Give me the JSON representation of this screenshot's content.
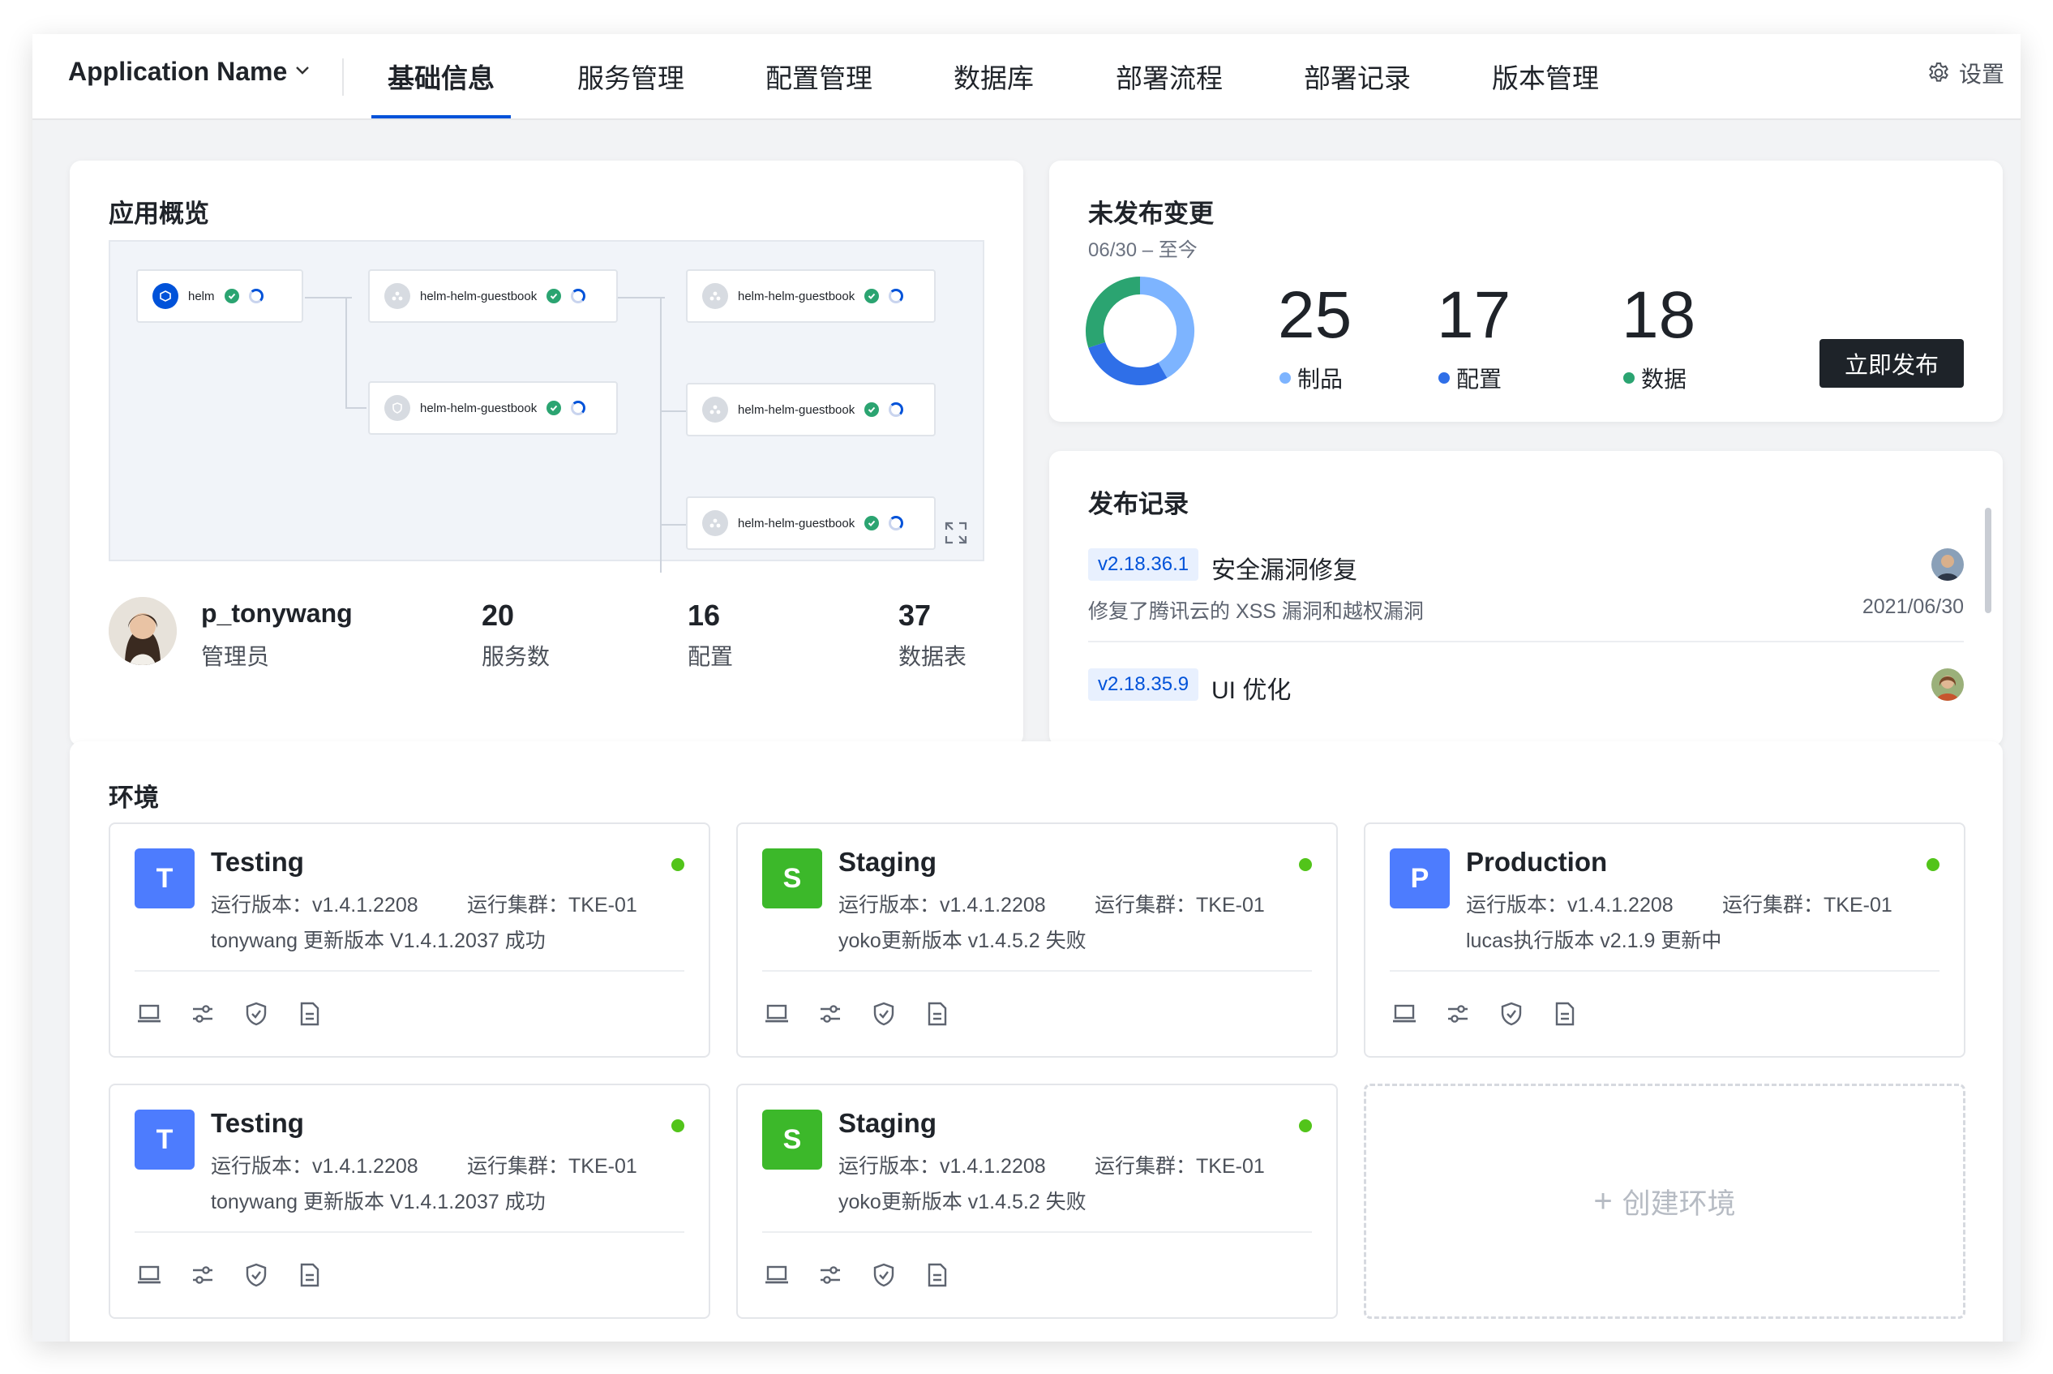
{
  "header": {
    "app_name": "Application Name",
    "tabs": [
      "基础信息",
      "服务管理",
      "配置管理",
      "数据库",
      "部署流程",
      "部署记录",
      "版本管理"
    ],
    "active_tab": "基础信息",
    "settings_label": "设置"
  },
  "overview": {
    "title": "应用概览",
    "nodes": [
      {
        "label": "helm"
      },
      {
        "label": "helm-helm-guestbook"
      },
      {
        "label": "helm-helm-guestbook"
      },
      {
        "label": "helm-helm-guestbook"
      },
      {
        "label": "helm-helm-guestbook"
      },
      {
        "label": "helm-helm-guestbook"
      }
    ],
    "user": {
      "name": "p_tonywang",
      "role": "管理员"
    },
    "stats": [
      {
        "value": "20",
        "label": "服务数"
      },
      {
        "value": "16",
        "label": "配置"
      },
      {
        "value": "37",
        "label": "数据表"
      }
    ]
  },
  "unpublished": {
    "title": "未发布变更",
    "date_range": "06/30 – 至今",
    "items": [
      {
        "value": "25",
        "label": "制品",
        "color": "#7db4ff"
      },
      {
        "value": "17",
        "label": "配置",
        "color": "#2f6fe8"
      },
      {
        "value": "18",
        "label": "数据",
        "color": "#2ba471"
      }
    ],
    "publish_button": "立即发布",
    "donut_colors": [
      "#7db4ff",
      "#2f6fe8",
      "#2ba471"
    ]
  },
  "releases": {
    "title": "发布记录",
    "items": [
      {
        "version": "v2.18.36.1",
        "title": "安全漏洞修复",
        "desc": "修复了腾讯云的 XSS 漏洞和越权漏洞",
        "date": "2021/06/30"
      },
      {
        "version": "v2.18.35.9",
        "title": "UI 优化"
      }
    ]
  },
  "environments": {
    "title": "环境",
    "cards": [
      {
        "badge": "T",
        "badge_color": "#4d7cfe",
        "name": "Testing",
        "version": "运行版本：v1.4.1.2208",
        "cluster": "运行集群：TKE-01",
        "update": "tonywang 更新版本 V1.4.1.2037 成功"
      },
      {
        "badge": "S",
        "badge_color": "#3cb82a",
        "name": "Staging",
        "version": "运行版本：v1.4.1.2208",
        "cluster": "运行集群：TKE-01",
        "update": "yoko更新版本 v1.4.5.2 失败"
      },
      {
        "badge": "P",
        "badge_color": "#4d7cfe",
        "name": "Production",
        "version": "运行版本：v1.4.1.2208",
        "cluster": "运行集群：TKE-01",
        "update": "lucas执行版本 v2.1.9 更新中"
      },
      {
        "badge": "T",
        "badge_color": "#4d7cfe",
        "name": "Testing",
        "version": "运行版本：v1.4.1.2208",
        "cluster": "运行集群：TKE-01",
        "update": "tonywang 更新版本 V1.4.1.2037 成功"
      },
      {
        "badge": "S",
        "badge_color": "#3cb82a",
        "name": "Staging",
        "version": "运行版本：v1.4.1.2208",
        "cluster": "运行集群：TKE-01",
        "update": "yoko更新版本 v1.4.5.2 失败"
      }
    ],
    "create_label": "创建环境"
  }
}
